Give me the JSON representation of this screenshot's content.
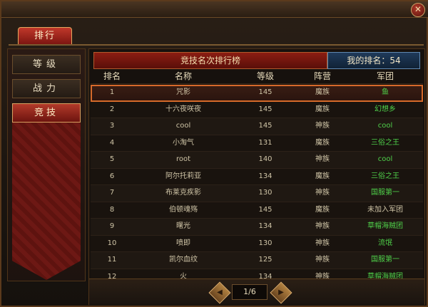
{
  "window": {
    "close_glyph": "✕"
  },
  "top_tab": {
    "label": "排行"
  },
  "menu": [
    {
      "label": "等级",
      "active": false
    },
    {
      "label": "战力",
      "active": false
    },
    {
      "label": "竞技",
      "active": true
    }
  ],
  "panel": {
    "title": "竞技名次排行榜",
    "my_rank": "我的排名：54"
  },
  "columns": {
    "rank": "排名",
    "name": "名称",
    "level": "等级",
    "camp": "阵营",
    "guild": "军团"
  },
  "rows": [
    {
      "rank": "1",
      "name": "咒影",
      "level": "145",
      "camp": "魔族",
      "guild": "鱼",
      "highlight": true
    },
    {
      "rank": "2",
      "name": "十六夜咲夜",
      "level": "145",
      "camp": "魔族",
      "guild": "幻想乡"
    },
    {
      "rank": "3",
      "name": "cool",
      "level": "145",
      "camp": "神族",
      "guild": "cool"
    },
    {
      "rank": "4",
      "name": "小淘气",
      "level": "131",
      "camp": "魔族",
      "guild": "三俗之王"
    },
    {
      "rank": "5",
      "name": "root",
      "level": "140",
      "camp": "神族",
      "guild": "cool"
    },
    {
      "rank": "6",
      "name": "阿尔托莉亚",
      "level": "134",
      "camp": "魔族",
      "guild": "三俗之王"
    },
    {
      "rank": "7",
      "name": "布莱克疾影",
      "level": "130",
      "camp": "神族",
      "guild": "国服第一"
    },
    {
      "rank": "8",
      "name": "伯顿魂殇",
      "level": "145",
      "camp": "魔族",
      "guild": "未加入军团",
      "no_guild": true
    },
    {
      "rank": "9",
      "name": "曙光",
      "level": "134",
      "camp": "神族",
      "guild": "草帽海贼团"
    },
    {
      "rank": "10",
      "name": "喷即",
      "level": "130",
      "camp": "神族",
      "guild": "流氓"
    },
    {
      "rank": "11",
      "name": "凯尔血纹",
      "level": "125",
      "camp": "神族",
      "guild": "国服第一"
    },
    {
      "rank": "12",
      "name": "火",
      "level": "134",
      "camp": "神族",
      "guild": "草帽海贼团"
    }
  ],
  "pager": {
    "page": "1/6",
    "prev_glyph": "◀",
    "next_glyph": "▶"
  },
  "colors": {
    "accent": "#d66a2a",
    "guild_green": "#4fd04a",
    "title_red": "#8b1d12"
  }
}
